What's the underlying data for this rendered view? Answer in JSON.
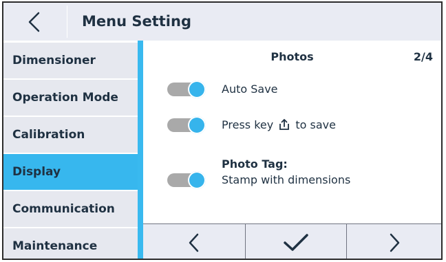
{
  "header": {
    "title": "Menu Setting",
    "back_icon": "chevron-left-icon"
  },
  "sidebar": {
    "items": [
      {
        "label": "Dimensioner",
        "active": false
      },
      {
        "label": "Operation Mode",
        "active": false
      },
      {
        "label": "Calibration",
        "active": false
      },
      {
        "label": "Display",
        "active": true
      },
      {
        "label": "Communication",
        "active": false
      },
      {
        "label": "Maintenance",
        "active": false
      }
    ]
  },
  "content": {
    "section_title": "Photos",
    "page_indicator": "2/4",
    "settings": [
      {
        "label": "Auto Save",
        "state": "on"
      },
      {
        "label_before": "Press key",
        "icon": "upload-key-icon",
        "label_after": "to save",
        "state": "on"
      },
      {
        "heading": "Photo Tag:",
        "label": "Stamp with dimensions",
        "state": "on"
      }
    ]
  },
  "bottom_bar": {
    "buttons": [
      "chevron-left-icon",
      "checkmark-icon",
      "chevron-right-icon"
    ]
  },
  "colors": {
    "accent": "#36b4ec",
    "header_bg": "#e9ebf3",
    "sidebar_bg": "#e6e8ef",
    "text": "#1f3142",
    "toggle_track": "#a9a9a9"
  }
}
